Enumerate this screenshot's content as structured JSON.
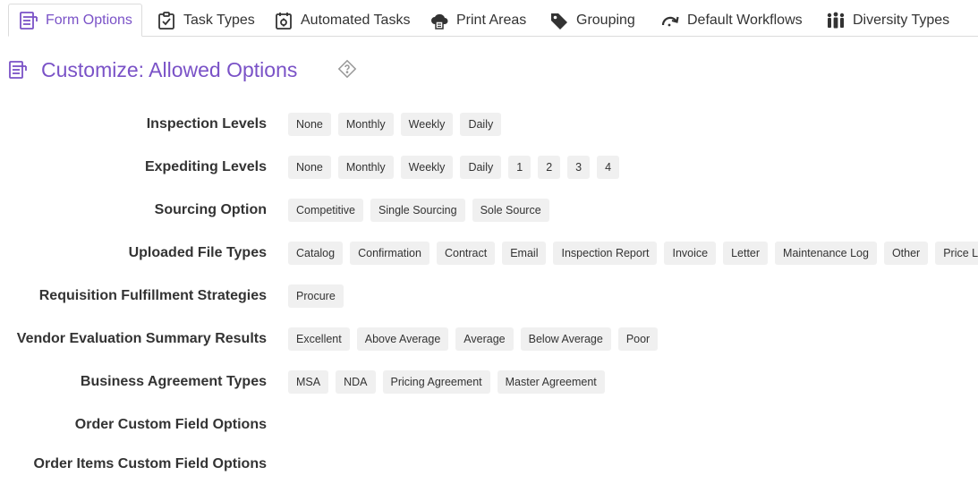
{
  "tabs": [
    {
      "label": "Form Options",
      "icon": "form-icon",
      "active": true
    },
    {
      "label": "Task Types",
      "icon": "clipboard-check-icon"
    },
    {
      "label": "Automated Tasks",
      "icon": "calendar-gear-icon"
    },
    {
      "label": "Print Areas",
      "icon": "printer-cloud-icon"
    },
    {
      "label": "Grouping",
      "icon": "tag-icon"
    },
    {
      "label": "Default Workflows",
      "icon": "redo-arrow-icon"
    },
    {
      "label": "Diversity Types",
      "icon": "people-icon"
    }
  ],
  "page": {
    "title": "Customize: Allowed Options"
  },
  "accent_color": "#7a52c7",
  "rows": [
    {
      "label": "Inspection Levels",
      "options": [
        "None",
        "Monthly",
        "Weekly",
        "Daily"
      ]
    },
    {
      "label": "Expediting Levels",
      "options": [
        "None",
        "Monthly",
        "Weekly",
        "Daily",
        "1",
        "2",
        "3",
        "4"
      ]
    },
    {
      "label": "Sourcing Option",
      "options": [
        "Competitive",
        "Single Sourcing",
        "Sole Source"
      ]
    },
    {
      "label": "Uploaded File Types",
      "options": [
        "Catalog",
        "Confirmation",
        "Contract",
        "Email",
        "Inspection Report",
        "Invoice",
        "Letter",
        "Maintenance Log",
        "Other",
        "Price List"
      ]
    },
    {
      "label": "Requisition Fulfillment Strategies",
      "options": [
        "Procure"
      ]
    },
    {
      "label": "Vendor Evaluation Summary Results",
      "options": [
        "Excellent",
        "Above Average",
        "Average",
        "Below Average",
        "Poor"
      ]
    },
    {
      "label": "Business Agreement Types",
      "options": [
        "MSA",
        "NDA",
        "Pricing Agreement",
        "Master Agreement"
      ]
    },
    {
      "label": "Order Custom Field Options",
      "options": []
    },
    {
      "label": "Order Items Custom Field Options",
      "options": []
    }
  ]
}
